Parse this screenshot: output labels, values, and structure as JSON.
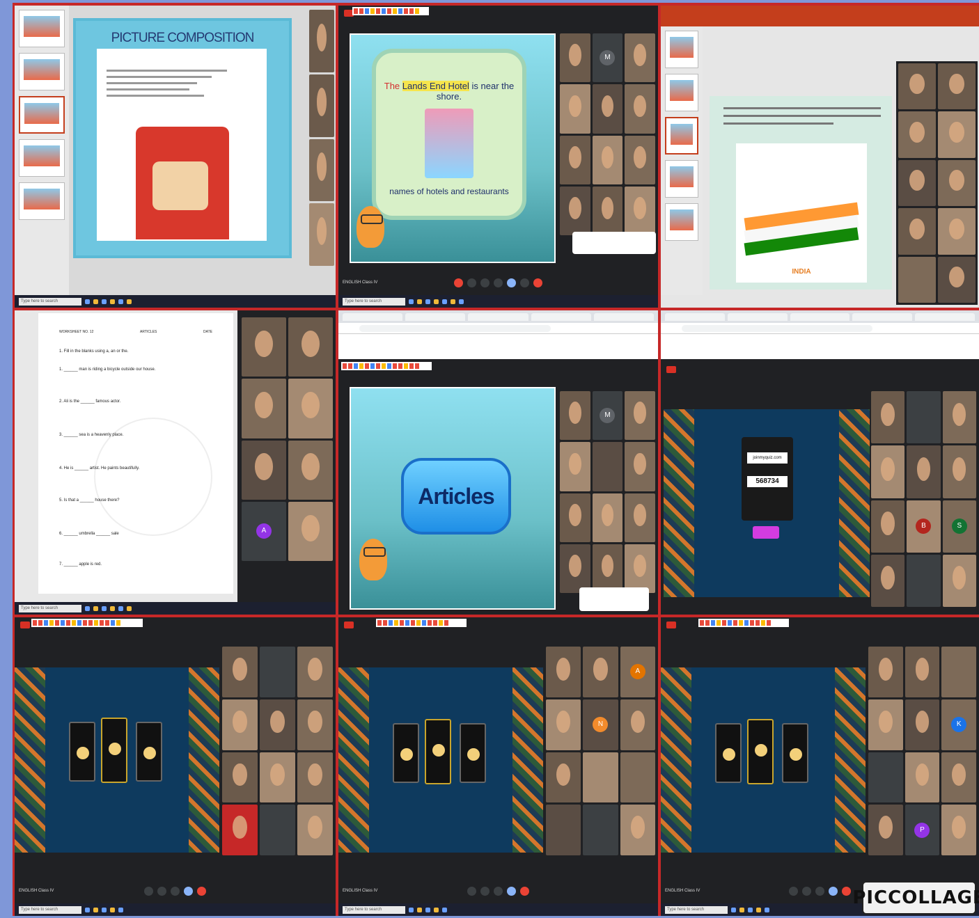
{
  "collage": {
    "watermark": "PICCOLLAGE"
  },
  "tile0": {
    "slide_title": "PICTURE COMPOSITION",
    "taskbar_search": "Type here to search"
  },
  "tile1": {
    "sentence_prefix": "The ",
    "sentence_highlight": "Lands End Hotel",
    "sentence_suffix": " is near the shore.",
    "caption": "names of hotels and restaurants",
    "meeting_caption": "ENGLISH Class IV"
  },
  "tile2": {
    "flag_text": "INDIA"
  },
  "tile3": {
    "doc_header": [
      "WORKSHEET NO. 12",
      "ARTICLES",
      "DATE"
    ],
    "instruction": "1. Fill in the blanks using a, an or the.",
    "lines": [
      "1. ______ man is riding a bicycle outside our house.",
      "2. Ali is the ______ famous actor.",
      "3. ______ sea is a heavenly place.",
      "4. He is ______ artist. He paints beautifully.",
      "5. Is that a ______ house there?",
      "6. ______ umbrella ______ sale",
      "7. ______ apple is red."
    ]
  },
  "tile4": {
    "button_text": "Articles"
  },
  "tile5": {
    "pin_field_label": "joinmyquiz.com",
    "pin_value": "568734"
  },
  "icons": [
    "mic-icon",
    "camera-icon",
    "captions-icon",
    "raise-hand-icon",
    "present-icon",
    "more-icon",
    "end-call-icon",
    "people-icon",
    "chat-icon"
  ]
}
